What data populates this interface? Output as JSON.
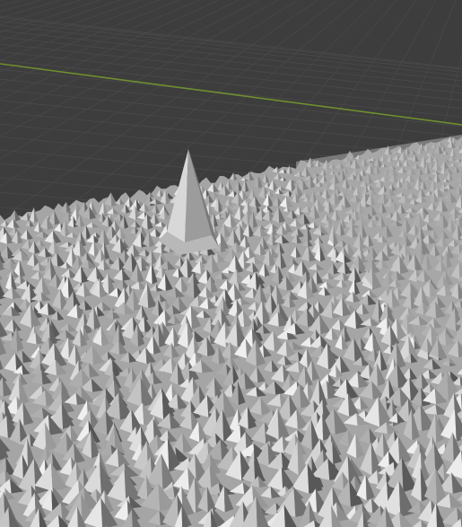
{
  "viewport": {
    "background_color": "#3d3d3d",
    "grid_color": "#4a4a4a",
    "x_axis_color": "#6f8f2f",
    "mesh_base_color": "#a5a5a5",
    "mesh_light_color": "#dcdcdc",
    "mesh_shadow_color": "#5a5a5a",
    "object": "terrain-mesh",
    "shading": "solid"
  }
}
